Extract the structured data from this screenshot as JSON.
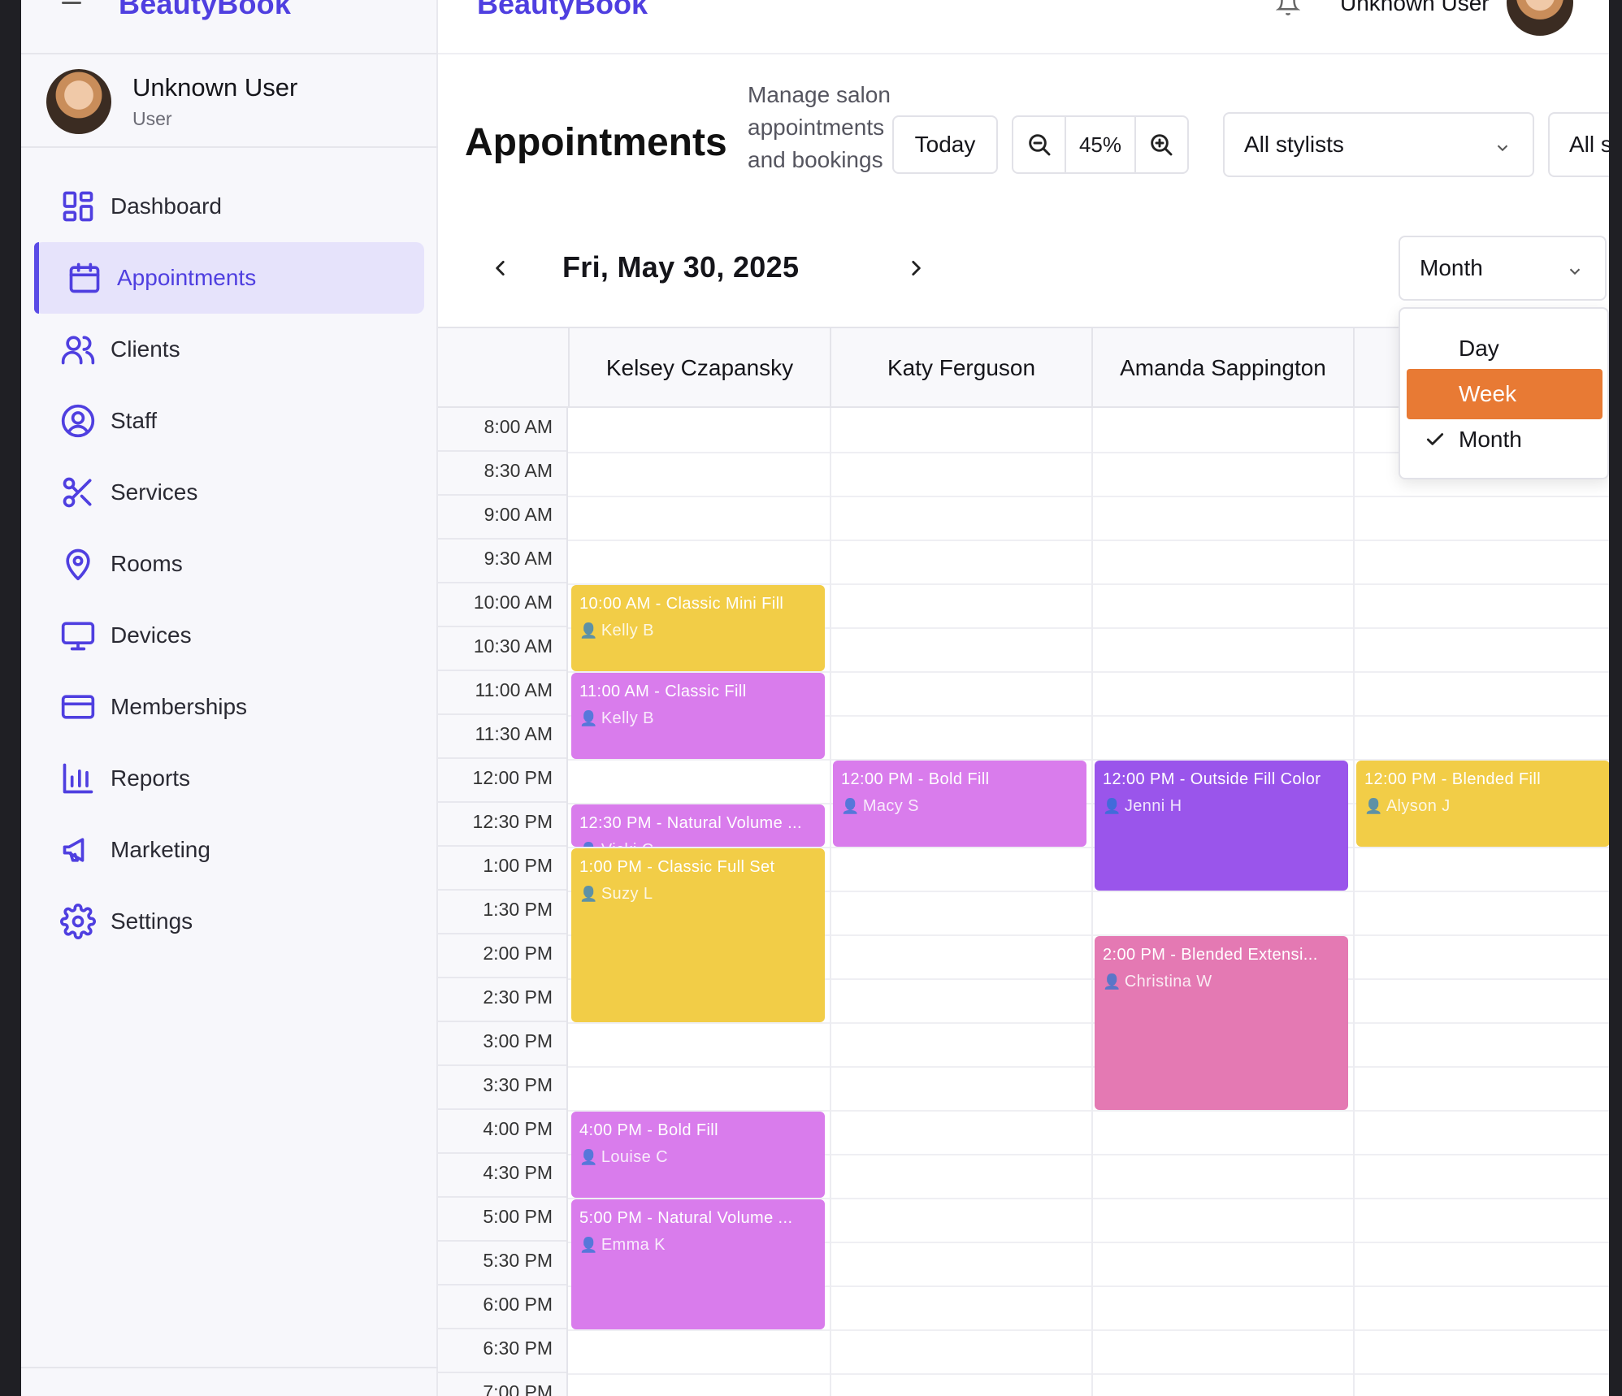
{
  "sidebar": {
    "brand": "BeautyBook",
    "user": {
      "name": "Unknown User",
      "role": "User"
    },
    "nav": [
      {
        "label": "Dashboard",
        "icon": "dashboard-icon"
      },
      {
        "label": "Appointments",
        "icon": "calendar-icon",
        "active": true
      },
      {
        "label": "Clients",
        "icon": "users-icon"
      },
      {
        "label": "Staff",
        "icon": "user-circle-icon"
      },
      {
        "label": "Services",
        "icon": "scissors-icon"
      },
      {
        "label": "Rooms",
        "icon": "map-pin-icon"
      },
      {
        "label": "Devices",
        "icon": "monitor-icon"
      },
      {
        "label": "Memberships",
        "icon": "credit-card-icon"
      },
      {
        "label": "Reports",
        "icon": "bar-chart-icon"
      },
      {
        "label": "Marketing",
        "icon": "megaphone-icon"
      },
      {
        "label": "Settings",
        "icon": "gear-icon"
      }
    ]
  },
  "header": {
    "brand": "BeautyBook",
    "user_name": "Unknown User"
  },
  "page": {
    "title": "Appointments",
    "subtitle": "Manage salon appointments and bookings",
    "today_label": "Today",
    "zoom_level": "45%",
    "stylist_filter": "All stylists",
    "service_filter": "All ser",
    "date": "Fri, May 30, 2025",
    "view": "Month"
  },
  "view_menu": {
    "options": [
      "Day",
      "Week",
      "Month"
    ],
    "highlighted": "Week",
    "checked": "Month"
  },
  "calendar": {
    "stylists": [
      "Kelsey Czapansky",
      "Katy Ferguson",
      "Amanda Sappington"
    ],
    "times": [
      "8:00 AM",
      "8:30 AM",
      "9:00 AM",
      "9:30 AM",
      "10:00 AM",
      "10:30 AM",
      "11:00 AM",
      "11:30 AM",
      "12:00 PM",
      "12:30 PM",
      "1:00 PM",
      "1:30 PM",
      "2:00 PM",
      "2:30 PM",
      "3:00 PM",
      "3:30 PM",
      "4:00 PM",
      "4:30 PM",
      "5:00 PM",
      "5:30 PM",
      "6:00 PM",
      "6:30 PM",
      "7:00 PM"
    ],
    "appointments": [
      {
        "col": 0,
        "start": "10:00 AM",
        "slots": 2,
        "title": "10:00 AM - Classic Mini Fill",
        "client": "Kelly B",
        "color": "#f2cd47"
      },
      {
        "col": 0,
        "start": "11:00 AM",
        "slots": 2,
        "title": "11:00 AM - Classic Fill",
        "client": "Kelly B",
        "color": "#d97cec"
      },
      {
        "col": 0,
        "start": "12:30 PM",
        "slots": 1,
        "title": "12:30 PM - Natural Volume ...",
        "client": "Vicki C",
        "color": "#d97cec"
      },
      {
        "col": 0,
        "start": "1:00 PM",
        "slots": 4,
        "title": "1:00 PM - Classic Full Set",
        "client": "Suzy L",
        "color": "#f2cd47"
      },
      {
        "col": 0,
        "start": "4:00 PM",
        "slots": 2,
        "title": "4:00 PM - Bold Fill",
        "client": "Louise C",
        "color": "#d97cec"
      },
      {
        "col": 0,
        "start": "5:00 PM",
        "slots": 3,
        "title": "5:00 PM - Natural Volume ...",
        "client": "Emma K",
        "color": "#d97cec"
      },
      {
        "col": 1,
        "start": "12:00 PM",
        "slots": 2,
        "title": "12:00 PM - Bold Fill",
        "client": "Macy S",
        "color": "#d97cec"
      },
      {
        "col": 2,
        "start": "12:00 PM",
        "slots": 3,
        "title": "12:00 PM - Outside Fill Color",
        "client": "Jenni H",
        "color": "#9a55eb"
      },
      {
        "col": 2,
        "start": "2:00 PM",
        "slots": 4,
        "title": "2:00 PM - Blended Extensi...",
        "client": "Christina W",
        "color": "#e479b3"
      },
      {
        "col": 3,
        "start": "12:00 PM",
        "slots": 2,
        "title": "12:00 PM - Blended Fill",
        "client": "Alyson J",
        "color": "#f2cd47"
      }
    ]
  }
}
